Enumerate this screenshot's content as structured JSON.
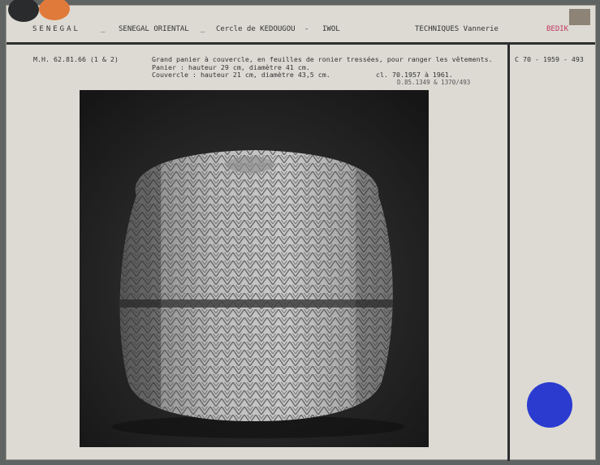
{
  "header": {
    "country": "SENEGAL",
    "sep1": "_",
    "region": "SENEGAL ORIENTAL",
    "sep2": "_",
    "cercle": "Cercle de KEDOUGOU",
    "sep3": "-",
    "locality": "IWOL",
    "category": "TECHNIQUES Vannerie",
    "people": "BEDIK"
  },
  "record": {
    "inventory_number": "M.H. 62.81.66 (1 & 2)",
    "description": "Grand panier à couvercle, en feuilles de ronier tressées, pour ranger les vêtements.",
    "panier_dims": "Panier : hauteur 29 cm, diamètre 41 cm.",
    "couvercle_dims": "Couvercle : hauteur 21 cm, diamètre 43,5 cm.",
    "collection": "cl. 70.1957 à 1961.",
    "references": "D.85.1349 & 1370/493",
    "photo_ref": "C 70 - 1959 - 493"
  },
  "colors": {
    "card": "#dcdad3",
    "orange_marker": "#e07a3a",
    "black_marker": "#2a2b2d",
    "blue_marker": "#2b3bd0"
  }
}
